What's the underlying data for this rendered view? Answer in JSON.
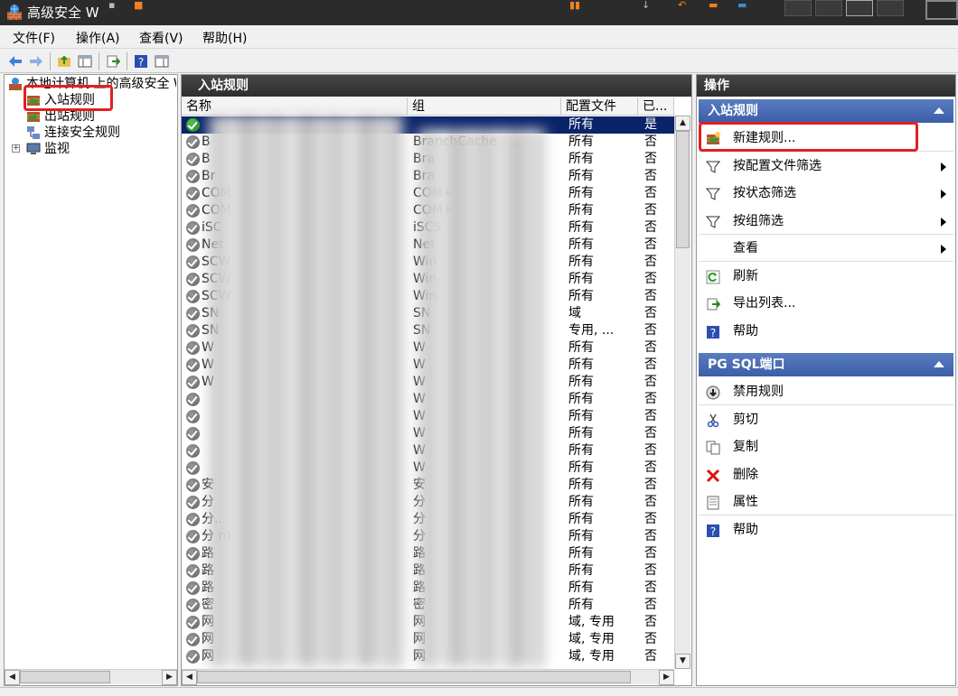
{
  "window": {
    "title": "高级安全 W"
  },
  "menu": {
    "items": [
      "文件(F)",
      "操作(A)",
      "查看(V)",
      "帮助(H)"
    ]
  },
  "tree": {
    "root": "本地计算机 上的高级安全 W",
    "items": [
      "入站规则",
      "出站规则",
      "连接安全规则",
      "监视"
    ]
  },
  "middle": {
    "title": "入站规则",
    "columns": [
      "名称",
      "组",
      "配置文件",
      "已..."
    ],
    "rows": [
      {
        "name": "",
        "group": "",
        "profile": "所有",
        "enabled": "是",
        "selected": true,
        "active": true
      },
      {
        "name": "B",
        "group": "BranchCache - ...",
        "profile": "所有",
        "enabled": "否"
      },
      {
        "name": "B",
        "group": "Bra",
        "profile": "所有",
        "enabled": "否"
      },
      {
        "name": "Br",
        "group": "Bra",
        "profile": "所有",
        "enabled": "否"
      },
      {
        "name": "COM",
        "group": "COM+",
        "profile": "所有",
        "enabled": "否"
      },
      {
        "name": "COM",
        "group": "COM+",
        "profile": "所有",
        "enabled": "否"
      },
      {
        "name": "iSC",
        "group": "iSCS",
        "profile": "所有",
        "enabled": "否"
      },
      {
        "name": "Net",
        "group": "Net",
        "profile": "所有",
        "enabled": "否"
      },
      {
        "name": "SCW",
        "group": "Win",
        "profile": "所有",
        "enabled": "否"
      },
      {
        "name": "SCW",
        "group": "Win",
        "profile": "所有",
        "enabled": "否"
      },
      {
        "name": "SCW",
        "group": "Win",
        "profile": "所有",
        "enabled": "否"
      },
      {
        "name": "SN",
        "group": "SN",
        "profile": "域",
        "enabled": "否"
      },
      {
        "name": "SN",
        "group": "SN",
        "profile": "专用, ...",
        "enabled": "否"
      },
      {
        "name": "W",
        "group": "W",
        "profile": "所有",
        "enabled": "否"
      },
      {
        "name": "W",
        "group": "W",
        "profile": "所有",
        "enabled": "否"
      },
      {
        "name": "W",
        "group": "W",
        "profile": "所有",
        "enabled": "否"
      },
      {
        "name": "",
        "group": "W",
        "profile": "所有",
        "enabled": "否"
      },
      {
        "name": "",
        "group": "W",
        "profile": "所有",
        "enabled": "否"
      },
      {
        "name": "",
        "group": "W",
        "profile": "所有",
        "enabled": "否"
      },
      {
        "name": "",
        "group": "W",
        "profile": "所有",
        "enabled": "否"
      },
      {
        "name": "",
        "group": "W",
        "profile": "所有",
        "enabled": "否"
      },
      {
        "name": "安",
        "group": "安",
        "profile": "所有",
        "enabled": "否"
      },
      {
        "name": "分",
        "group": "分",
        "profile": "所有",
        "enabled": "否"
      },
      {
        "name": "分...",
        "group": "分",
        "profile": "所有",
        "enabled": "否"
      },
      {
        "name": "分 n)",
        "group": "分",
        "profile": "所有",
        "enabled": "否"
      },
      {
        "name": "路",
        "group": "路",
        "profile": "所有",
        "enabled": "否"
      },
      {
        "name": "路",
        "group": "路",
        "profile": "所有",
        "enabled": "否"
      },
      {
        "name": "路",
        "group": "路",
        "profile": "所有",
        "enabled": "否"
      },
      {
        "name": "密",
        "group": "密",
        "profile": "所有",
        "enabled": "否"
      },
      {
        "name": "网",
        "group": "网",
        "profile": "域, 专用",
        "enabled": "否"
      },
      {
        "name": "网",
        "group": "网",
        "profile": "域, 专用",
        "enabled": "否"
      },
      {
        "name": "网",
        "group": "网",
        "profile": "域, 专用",
        "enabled": "否"
      }
    ]
  },
  "actions": {
    "title": "操作",
    "section1": {
      "title": "入站规则",
      "items": [
        {
          "label": "新建规则...",
          "icon": "new-rule-icon"
        },
        {
          "label": "按配置文件筛选",
          "icon": "filter-icon",
          "submenu": true
        },
        {
          "label": "按状态筛选",
          "icon": "filter-icon",
          "submenu": true
        },
        {
          "label": "按组筛选",
          "icon": "filter-icon",
          "submenu": true
        },
        {
          "label": "查看",
          "icon": "",
          "submenu": true
        },
        {
          "label": "刷新",
          "icon": "refresh-icon"
        },
        {
          "label": "导出列表...",
          "icon": "export-icon"
        },
        {
          "label": "帮助",
          "icon": "help-icon"
        }
      ]
    },
    "section2": {
      "title": "PG SQL端口",
      "items": [
        {
          "label": "禁用规则",
          "icon": "disable-icon"
        },
        {
          "label": "剪切",
          "icon": "cut-icon"
        },
        {
          "label": "复制",
          "icon": "copy-icon"
        },
        {
          "label": "删除",
          "icon": "delete-icon"
        },
        {
          "label": "属性",
          "icon": "properties-icon"
        },
        {
          "label": "帮助",
          "icon": "help-icon"
        }
      ]
    }
  },
  "colors": {
    "selection": "#0a246a",
    "section_header": "#3a5ea8",
    "highlight_box": "#e02020"
  }
}
